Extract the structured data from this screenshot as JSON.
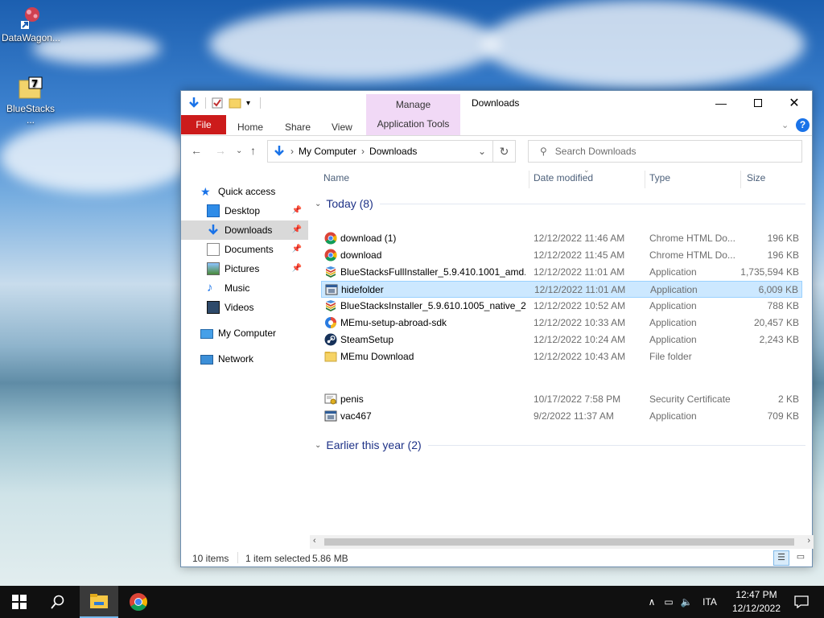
{
  "desktop": {
    "icons": [
      {
        "label": "DataWagon..."
      },
      {
        "label": "BlueStacks ..."
      }
    ]
  },
  "window": {
    "title": "Downloads",
    "manage_tab": "Manage",
    "app_tools_tab": "Application Tools",
    "ribbon_tabs": [
      "File",
      "Home",
      "Share",
      "View"
    ],
    "breadcrumb": [
      "My Computer",
      "Downloads"
    ],
    "search_placeholder": "Search Downloads"
  },
  "nav_pane": {
    "items": [
      {
        "label": "Quick access"
      },
      {
        "label": "Desktop"
      },
      {
        "label": "Downloads"
      },
      {
        "label": "Documents"
      },
      {
        "label": "Pictures"
      },
      {
        "label": "Music"
      },
      {
        "label": "Videos"
      },
      {
        "label": "My Computer"
      },
      {
        "label": "Network"
      }
    ]
  },
  "columns": [
    "Name",
    "Date modified",
    "Type",
    "Size"
  ],
  "groups": [
    {
      "title": "Today (8)",
      "files": [
        {
          "name": "download (1)",
          "date": "12/12/2022 11:46 AM",
          "type": "Chrome HTML Do...",
          "size": "196 KB",
          "icon": "chrome-icon"
        },
        {
          "name": "download",
          "date": "12/12/2022 11:45 AM",
          "type": "Chrome HTML Do...",
          "size": "196 KB",
          "icon": "chrome-icon"
        },
        {
          "name": "BlueStacksFullInstaller_5.9.410.1001_amd...",
          "date": "12/12/2022 11:01 AM",
          "type": "Application",
          "size": "1,735,594 KB",
          "icon": "bluestacks-icon"
        },
        {
          "name": "hidefolder",
          "date": "12/12/2022 11:01 AM",
          "type": "Application",
          "size": "6,009 KB",
          "icon": "application-icon"
        },
        {
          "name": "BlueStacksInstaller_5.9.610.1005_native_2...",
          "date": "12/12/2022 10:52 AM",
          "type": "Application",
          "size": "788 KB",
          "icon": "bluestacks-icon"
        },
        {
          "name": "MEmu-setup-abroad-sdk",
          "date": "12/12/2022 10:33 AM",
          "type": "Application",
          "size": "20,457 KB",
          "icon": "memu-icon"
        },
        {
          "name": "SteamSetup",
          "date": "12/12/2022 10:24 AM",
          "type": "Application",
          "size": "2,243 KB",
          "icon": "steam-icon"
        },
        {
          "name": "MEmu Download",
          "date": "12/12/2022 10:43 AM",
          "type": "File folder",
          "size": "",
          "icon": "folder-icon"
        }
      ]
    },
    {
      "title": "Earlier this year (2)",
      "files": [
        {
          "name": "penis",
          "date": "10/17/2022 7:58 PM",
          "type": "Security Certificate",
          "size": "2 KB",
          "icon": "certificate-icon"
        },
        {
          "name": "vac467",
          "date": "9/2/2022 11:37 AM",
          "type": "Application",
          "size": "709 KB",
          "icon": "application-icon"
        }
      ]
    }
  ],
  "selected_file": "hidefolder",
  "status": {
    "items_count": "10 items",
    "selection": "1 item selected",
    "selection_size": "5.86 MB"
  },
  "taskbar": {
    "language": "ITA",
    "time": "12:47 PM",
    "date": "12/12/2022"
  },
  "colors": {
    "accent": "#1a73e8",
    "file_tab": "#cc1b1b",
    "manage_tab": "#f1d9f6",
    "selection": "#cce8ff",
    "group_title": "#1e3287"
  }
}
